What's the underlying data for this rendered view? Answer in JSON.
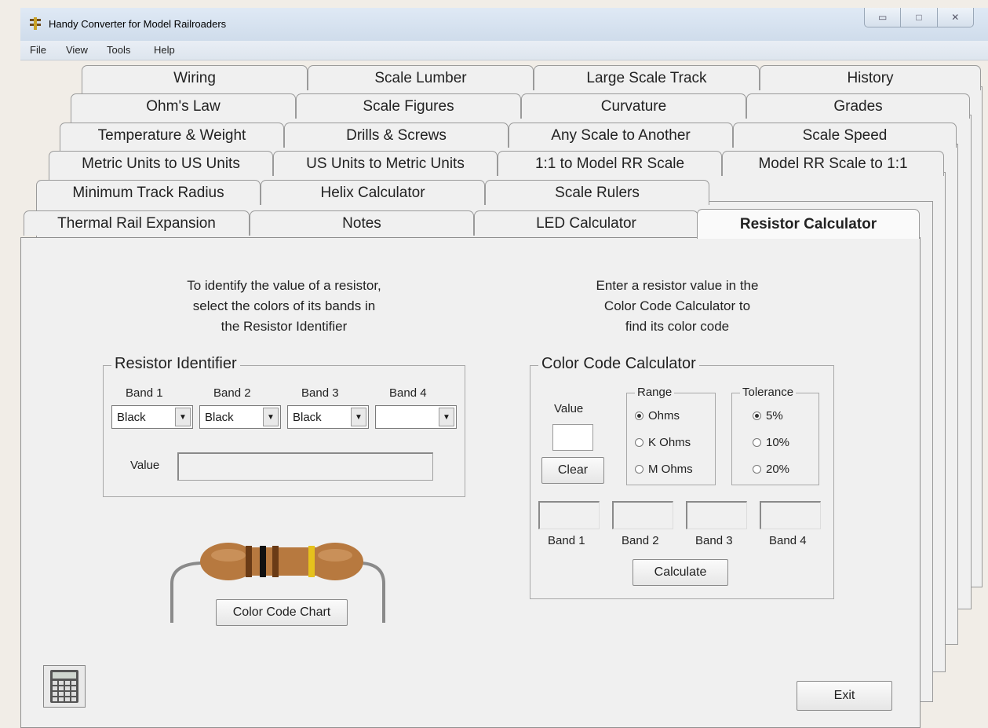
{
  "window": {
    "title": "Handy Converter for Model Railroaders"
  },
  "menu": [
    "File",
    "View",
    "Tools",
    "Help"
  ],
  "tabs": {
    "row1": [
      "Wiring",
      "Scale Lumber",
      "Large Scale Track",
      "History"
    ],
    "row2": [
      "Ohm's Law",
      "Scale Figures",
      "Curvature",
      "Grades"
    ],
    "row3": [
      "Temperature & Weight",
      "Drills & Screws",
      "Any Scale to Another",
      "Scale Speed"
    ],
    "row4": [
      "Metric Units to US Units",
      "US Units to Metric Units",
      "1:1 to Model RR Scale",
      "Model RR Scale to 1:1"
    ],
    "row5": [
      "Minimum Track Radius",
      "Helix Calculator",
      "Scale Rulers"
    ],
    "row6": [
      "Thermal Rail Expansion",
      "Notes",
      "LED Calculator",
      "Resistor Calculator"
    ],
    "active": "Resistor Calculator"
  },
  "left": {
    "instructions": "To identify the value of a resistor,\nselect the colors of its bands in\nthe Resistor Identifier",
    "group_title": "Resistor Identifier",
    "band_labels": [
      "Band 1",
      "Band 2",
      "Band 3",
      "Band 4"
    ],
    "band_values": [
      "Black",
      "Black",
      "Black",
      ""
    ],
    "value_label": "Value",
    "value": "",
    "chart_button": "Color Code Chart"
  },
  "right": {
    "instructions": "Enter a resistor value in the\nColor Code Calculator to\nfind its color code",
    "group_title": "Color Code Calculator",
    "value_label": "Value",
    "value": "",
    "clear_button": "Clear",
    "range_title": "Range",
    "range_options": [
      "Ohms",
      "K Ohms",
      "M Ohms"
    ],
    "range_selected": "Ohms",
    "tolerance_title": "Tolerance",
    "tolerance_options": [
      "5%",
      "10%",
      "20%"
    ],
    "tolerance_selected": "5%",
    "band_labels": [
      "Band 1",
      "Band 2",
      "Band 3",
      "Band 4"
    ],
    "calculate_button": "Calculate"
  },
  "exit_button": "Exit",
  "icons": {
    "calculator": "calculator-icon",
    "app": "railroad-crossing-icon",
    "resistor": "resistor-image"
  }
}
